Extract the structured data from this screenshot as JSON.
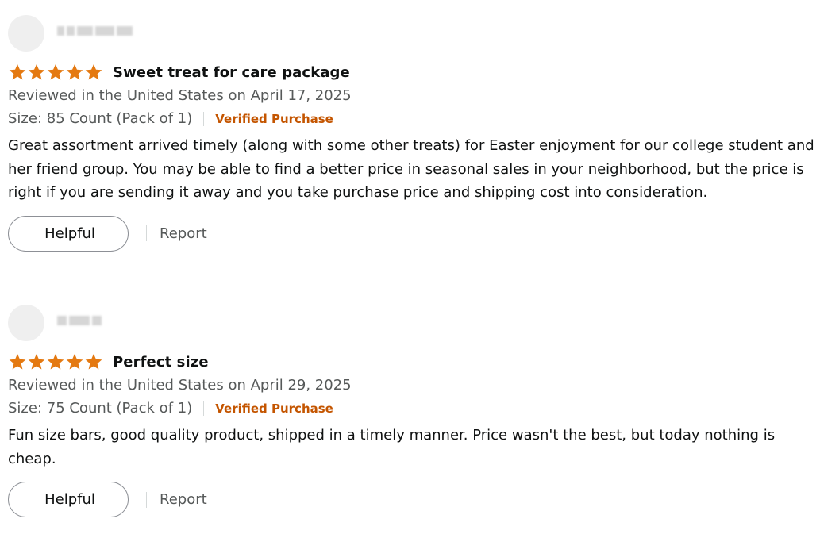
{
  "reviews": [
    {
      "rating": 5,
      "title": "Sweet treat for care package",
      "date": "Reviewed in the United States on April 17, 2025",
      "size": "Size: 85 Count (Pack of 1)",
      "verified": "Verified Purchase",
      "body": "Great assortment arrived timely (along with some other treats) for Easter enjoyment for our college student and her friend group. You may be able to find a better price in seasonal sales in your neighborhood, but the price is right if you are sending it away and you take purchase price and shipping cost into consideration.",
      "helpful_label": "Helpful",
      "report_label": "Report"
    },
    {
      "rating": 5,
      "title": "Perfect size",
      "date": "Reviewed in the United States on April 29, 2025",
      "size": "Size: 75 Count (Pack of 1)",
      "verified": "Verified Purchase",
      "body": "Fun size bars, good quality product, shipped in a timely manner. Price wasn't the best, but today nothing is cheap.",
      "helpful_label": "Helpful",
      "report_label": "Report"
    }
  ],
  "colors": {
    "star": "#e47911",
    "verified": "#c45500",
    "muted_text": "#565959",
    "text": "#0f1111"
  },
  "icons": {
    "avatar": "default-avatar-icon",
    "star": "star-icon"
  }
}
